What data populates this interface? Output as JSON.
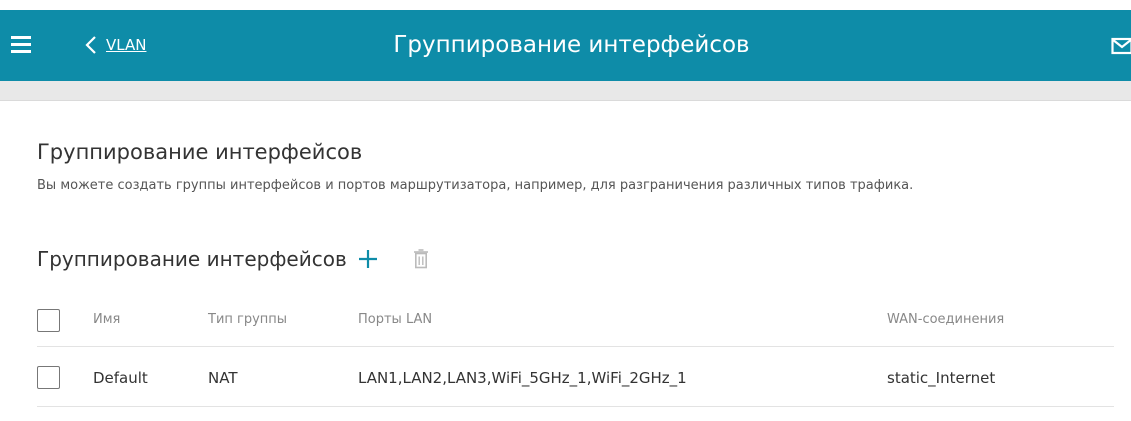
{
  "header": {
    "back_label": "VLAN",
    "title": "Группирование интерфейсов",
    "menu_icon": "hamburger-menu-icon",
    "back_icon": "chevron-left-icon",
    "mail_icon": "mail-icon"
  },
  "main": {
    "title": "Группирование интерфейсов",
    "description": "Вы можете создать группы интерфейсов и портов маршрутизатора, например, для разграничения различных типов трафика."
  },
  "section": {
    "title": "Группирование интерфейсов",
    "add_icon": "plus-icon",
    "delete_icon": "trash-icon"
  },
  "table": {
    "columns": [
      "Имя",
      "Тип группы",
      "Порты LAN",
      "WAN-соединения"
    ],
    "rows": [
      {
        "name": "Default",
        "type": "NAT",
        "ports": "LAN1,LAN2,LAN3,WiFi_5GHz_1,WiFi_2GHz_1",
        "wan": "static_Internet"
      }
    ]
  },
  "colors": {
    "accent": "#0e8ca8",
    "add_icon": "#0e8ca8"
  }
}
